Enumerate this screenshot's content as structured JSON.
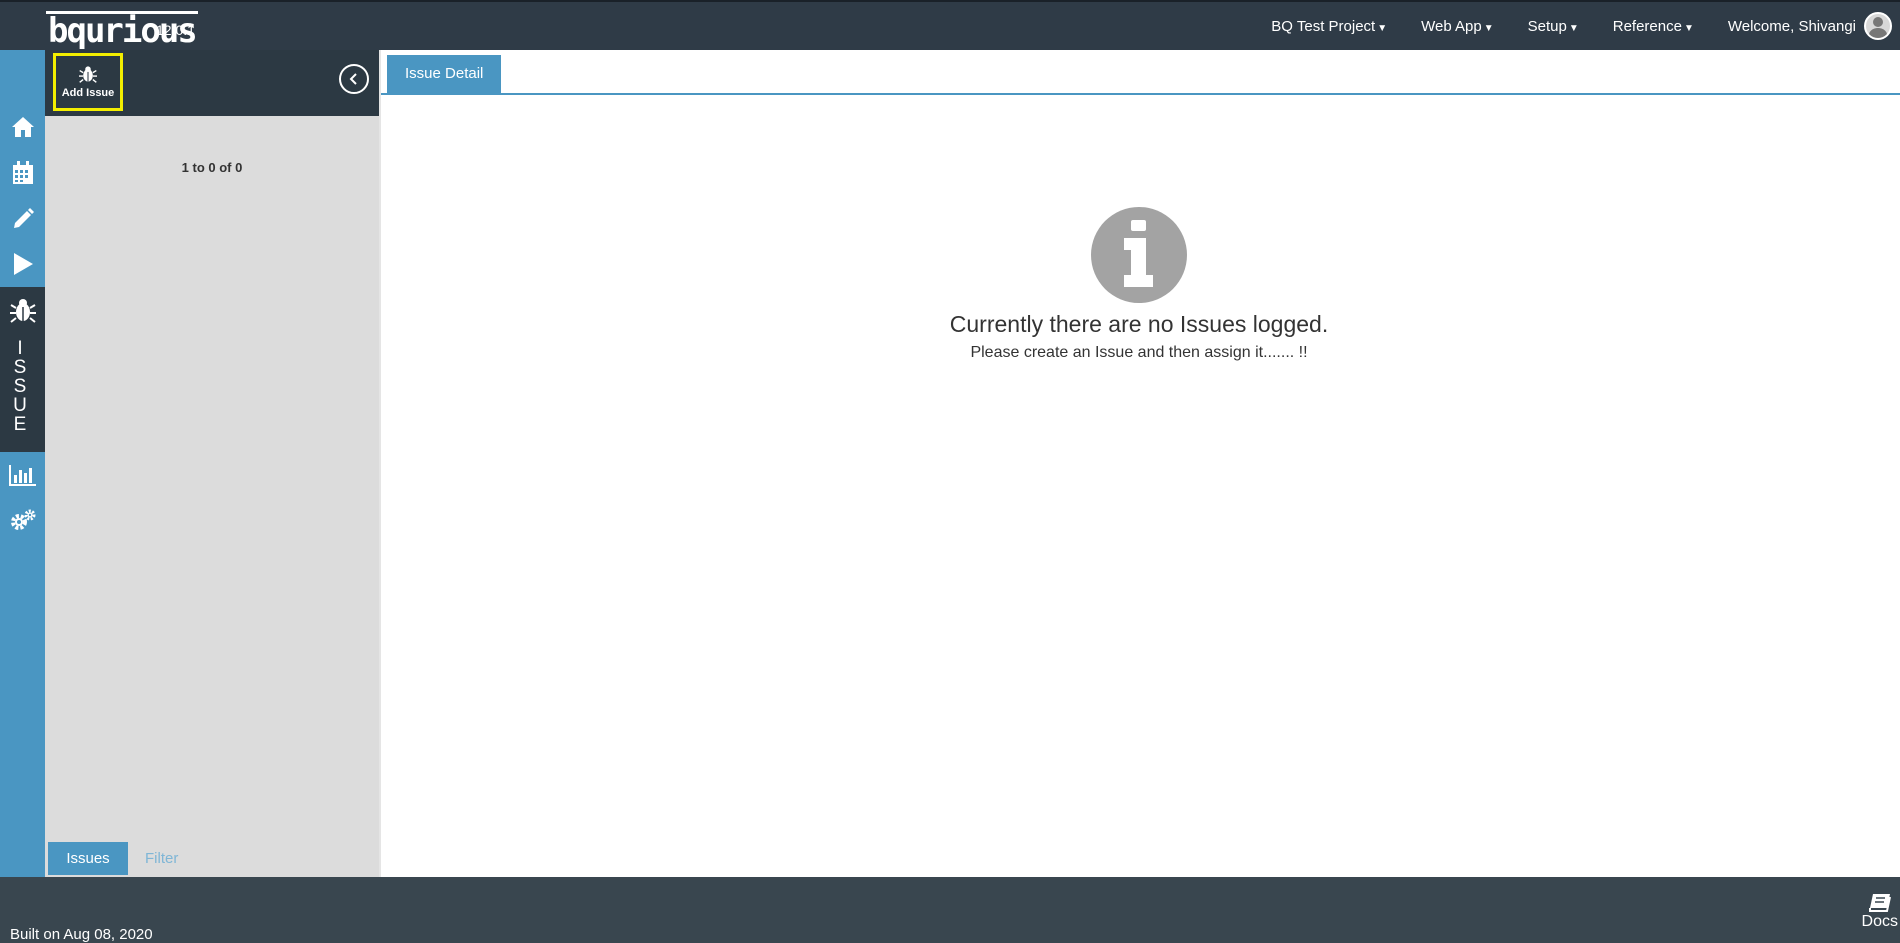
{
  "app": {
    "brand": "bqurious",
    "version": "12.0.1"
  },
  "topnav": {
    "items": [
      {
        "label": "BQ Test Project"
      },
      {
        "label": "Web App"
      },
      {
        "label": "Setup"
      },
      {
        "label": "Reference"
      }
    ],
    "welcome": "Welcome, Shivangi"
  },
  "rail": {
    "icons": [
      "home-icon",
      "calendar-icon",
      "pencil-icon",
      "play-icon",
      "bug-icon",
      "bar-chart-icon",
      "cogs-icon"
    ],
    "active_section_letters": [
      "I",
      "S",
      "S",
      "U",
      "E"
    ]
  },
  "panel": {
    "add_issue_label": "Add Issue",
    "pager": "1 to 0 of 0",
    "tabs": [
      {
        "label": "Issues",
        "active": true
      },
      {
        "label": "Filter",
        "active": false
      }
    ]
  },
  "main": {
    "tab_label": "Issue Detail",
    "empty_title": "Currently there are no Issues logged.",
    "empty_subtitle": "Please create an Issue and then assign it....... !!"
  },
  "footer": {
    "built": "Built on Aug 08, 2020",
    "docs_label": "Docs"
  },
  "colors": {
    "topbar": "#2f3b47",
    "rail": "#4a96c2",
    "accent": "#4a96c2",
    "panel_bg": "#dcdcdc",
    "highlight": "#f3ee00"
  }
}
